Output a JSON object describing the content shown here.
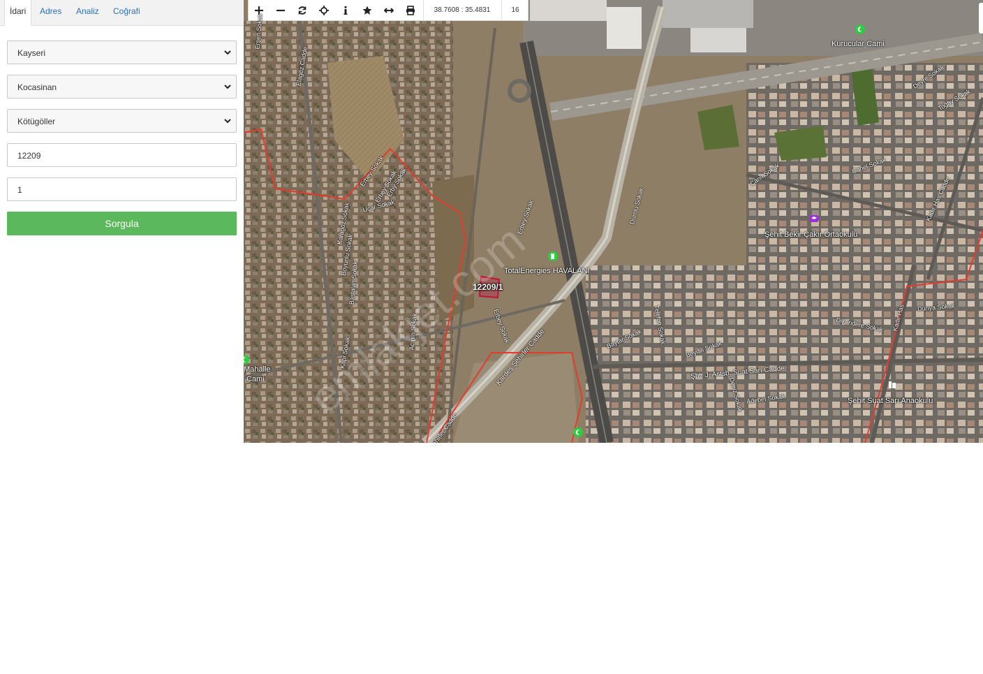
{
  "tabs": [
    {
      "label": "İdari",
      "active": true
    },
    {
      "label": "Adres",
      "active": false
    },
    {
      "label": "Analiz",
      "active": false
    },
    {
      "label": "Coğrafi",
      "active": false
    }
  ],
  "form": {
    "province": "Kayseri",
    "district": "Kocasinan",
    "neighborhood": "Kötügöller",
    "block": "12209",
    "parcel": "1",
    "submit_label": "Sorgula"
  },
  "toolbar": {
    "tools": [
      {
        "icon": "zoom-in-icon",
        "glyph": "+"
      },
      {
        "icon": "zoom-out-icon",
        "glyph": "−"
      },
      {
        "icon": "refresh-icon",
        "glyph": "⟳"
      },
      {
        "icon": "locate-icon",
        "glyph": "⌖"
      },
      {
        "icon": "info-icon",
        "glyph": "i"
      },
      {
        "icon": "star-icon",
        "glyph": "★"
      },
      {
        "icon": "measure-icon",
        "glyph": "↔"
      },
      {
        "icon": "print-icon",
        "glyph": "⎙"
      }
    ],
    "coordinates": "38.7608 : 35.4831",
    "zoom_level": "16"
  },
  "map": {
    "parcel_label": "12209/1",
    "places": {
      "mosque_north": "Kurucular Cami",
      "fuel_station": "TotalEnergies HAVALANI",
      "school": "Şehit Bekir Çakır Ortaokulu",
      "kindergarten": "Şehit Suat Sarı Anaokulu",
      "mosque_west_1": "Mahalle",
      "mosque_west_2": "Cami"
    },
    "streets": {
      "s1": "Elagöz Cadde",
      "s2": "Erbey Sokak",
      "s3": "Erbey Sokak",
      "s4": "Erby Sokak",
      "s5": "Uçar Sokak",
      "s6": "Karagöz Sokak",
      "s7": "Boyunlu Sokak",
      "s8": "Bastalan Sokak",
      "s9": "Acıpın Sokak",
      "s10": "Kapı Sokak",
      "s11": "Erbey Sokak",
      "s12": "Erbey Sokak",
      "s13": "Kardeş Şehirler Cadde",
      "s14": "Şehirler Cadde",
      "s15": "Dumlu Sokak",
      "s16": "Canlı Sokak",
      "s17": "Canel Sokak",
      "s18": "Devre Sokak",
      "s19": "Toğay Sokak",
      "s20": "Kadir Has Cadde",
      "s21": "Telefon Sokak",
      "s22": "Baytar Sokak",
      "s23": "Beydili Sokak",
      "s24": "Şht. J. Astsb. Suat Sarı Cadde",
      "s25": "Dikendere Sokak",
      "s26": "Dünya Sokak",
      "s27": "Kadir Has",
      "s28": "Adebel Sokak",
      "s29": "Erşen Sokak",
      "s30": "Deniz Sokak"
    },
    "watermark": "emlakjet.com",
    "colors": {
      "boundary": "#e53b2c",
      "parcel": "#c0143c",
      "poi_green": "#2ecc40",
      "poi_purple": "#9b30d9",
      "button_green": "#5cb85c"
    }
  }
}
